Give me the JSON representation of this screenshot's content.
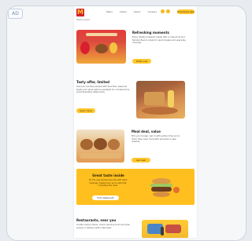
{
  "app": {
    "corner_badge": "AD"
  },
  "header": {
    "logo_letter": "M",
    "brand": "McDonald's",
    "nav": [
      "Menu",
      "Deals",
      "About",
      "Careers"
    ],
    "cta_label": "Download App"
  },
  "sections": {
    "s1": {
      "title": "Refreshing moments",
      "body": "Enjoy freshly prepared meals with a crisp drink and familiar flavors made for quick breaks and everyday cravings.",
      "cta_label": "Order now"
    },
    "s2": {
      "title": "Tasty offer, limited",
      "body": "Discover bundles packed with favorites, seasonal treats and value options available for a limited time at participating restaurants.",
      "cta_label": "Learn more"
    },
    "s3": {
      "title": "Meal deal, value",
      "body": "Pick your burger, pair it with golden fries and a drink, then save more with exclusive in-app rewards.",
      "cta_label": "Get deal"
    },
    "s4": {
      "title": "Great taste inside",
      "body": "Try the new stacked favorite with fresh toppings, toasted bun and a side that completes the meal.",
      "cta_label": "Find restaurant"
    },
    "s5": {
      "title": "Restaurants, near you",
      "body": "Locate nearby stores, check opening hours and plan pickup or delivery with a few taps."
    }
  }
}
